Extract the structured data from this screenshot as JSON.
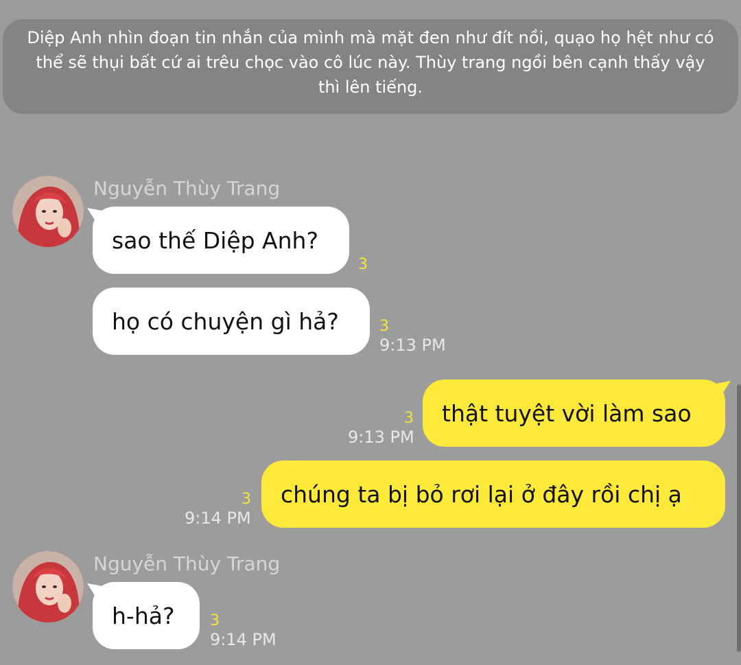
{
  "narration": "Diệp Anh nhìn đoạn tin nhắn của mình mà mặt đen như đít nồi, quạo họ hệt như có thể sẽ thụi bất cứ ai trêu chọc vào cô lúc này. Thùy trang ngồi bên cạnh thấy vậy thì lên tiếng.",
  "groups": [
    {
      "sender": "Nguyễn Thùy Trang",
      "messages": [
        {
          "text": "sao thế Diệp Anh?",
          "count": "3"
        },
        {
          "text": "họ có chuyện gì hả?",
          "count": "3",
          "time": "9:13 PM"
        }
      ]
    },
    {
      "sender": "me",
      "messages": [
        {
          "text": "thật tuyệt vời làm sao",
          "count": "3",
          "time": "9:13 PM"
        },
        {
          "text": "chúng ta bị bỏ rơi lại ở đây rồi chị ạ",
          "count": "3",
          "time": "9:14 PM"
        }
      ]
    },
    {
      "sender": "Nguyễn Thùy Trang",
      "messages": [
        {
          "text": "h-hả?",
          "count": "3",
          "time": "9:14 PM"
        }
      ]
    }
  ],
  "colors": {
    "background": "#9c9c9c",
    "narration_bg": "#848484",
    "incoming_bubble": "#ffffff",
    "outgoing_bubble": "#fde93a",
    "unread_count": "#f4e63a"
  }
}
